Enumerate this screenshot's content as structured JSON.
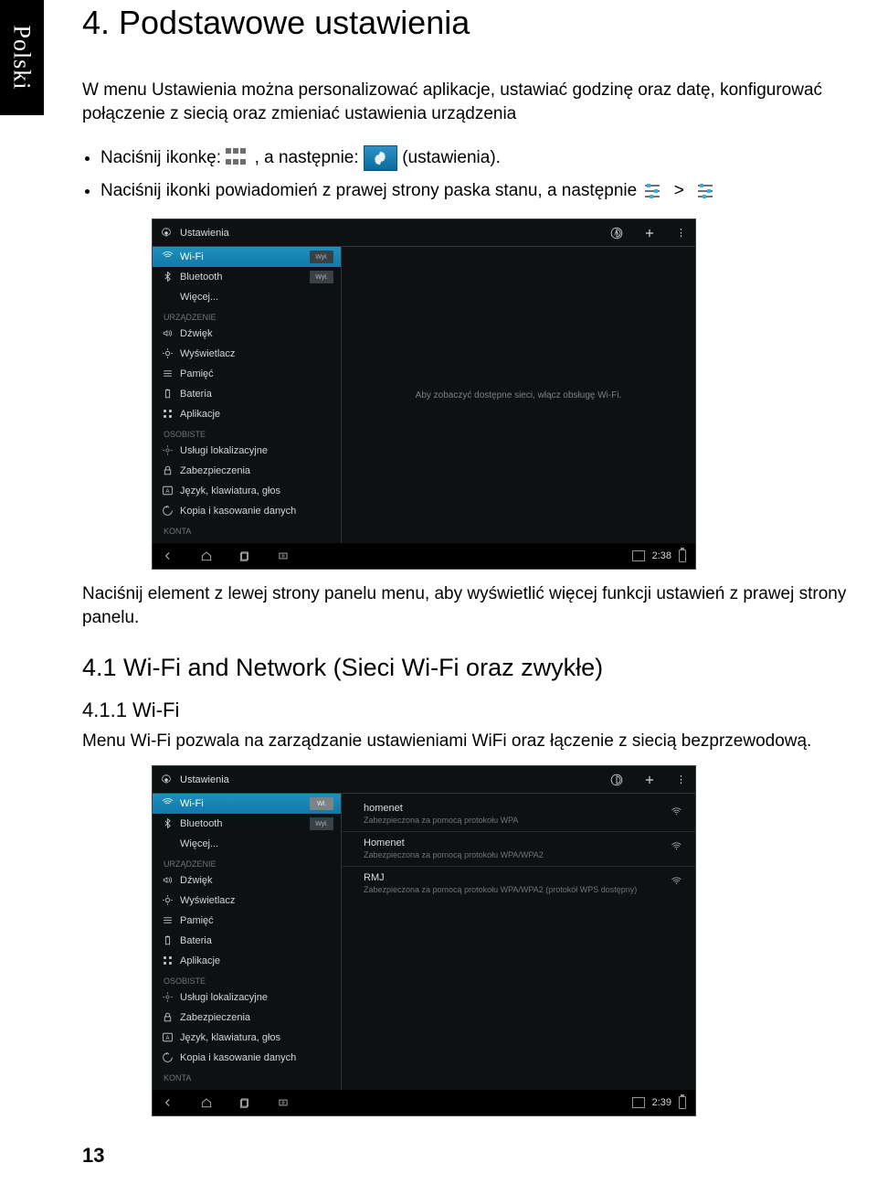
{
  "sidetab": "Polski",
  "heading": "4.  Podstawowe ustawienia",
  "intro": "W menu Ustawienia można personalizować aplikacje, ustawiać godzinę oraz datę, konfigurować połączenie z siecią oraz zmieniać ustawienia urządzenia",
  "bullet1": {
    "t1": "Naciśnij ikonkę:",
    "t2": ",  a następnie:",
    "t3": "(ustawienia).",
    "icons": {
      "apps": "apps-icon",
      "settings_tile": "settings-tile-icon"
    }
  },
  "bullet2": {
    "t1": "Naciśnij ikonki powiadomień z prawej strony paska stanu, a następnie",
    "gt": ">",
    "icons": {
      "sliders1": "quick-sliders-icon",
      "sliders2": "quick-sliders-icon"
    }
  },
  "after_img": "Naciśnij element z lewej strony panelu menu, aby wyświetlić więcej funkcji ustawień z prawej strony panelu.",
  "sub_h2": "4.1   Wi-Fi and Network (Sieci Wi-Fi oraz zwykłe)",
  "sub_h3": "4.1.1   Wi-Fi",
  "wifi_intro": "Menu Wi-Fi pozwala na zarządzanie ustawieniami WiFi oraz łączenie z siecią bezprzewodową.",
  "page_number": "13",
  "screenshot1": {
    "title": "Ustawienia",
    "topbar_icons": [
      "wps-icon",
      "plus-icon",
      "overflow-icon"
    ],
    "sidebar": {
      "primary": [
        {
          "label": "Wi-Fi",
          "icon": "wifi-icon",
          "active": true,
          "toggle": "Wył."
        },
        {
          "label": "Bluetooth",
          "icon": "bluetooth-icon",
          "toggle": "Wył."
        },
        {
          "label": "Więcej...",
          "icon": ""
        }
      ],
      "device_header": "URZĄDZENIE",
      "device": [
        {
          "label": "Dźwięk",
          "icon": "sound-icon"
        },
        {
          "label": "Wyświetlacz",
          "icon": "display-icon"
        },
        {
          "label": "Pamięć",
          "icon": "storage-icon"
        },
        {
          "label": "Bateria",
          "icon": "battery-icon"
        },
        {
          "label": "Aplikacje",
          "icon": "apps-small-icon"
        }
      ],
      "personal_header": "OSOBISTE",
      "personal": [
        {
          "label": "Usługi lokalizacyjne",
          "icon": "location-icon"
        },
        {
          "label": "Zabezpieczenia",
          "icon": "lock-icon"
        },
        {
          "label": "Język, klawiatura, głos",
          "icon": "keyboard-icon"
        },
        {
          "label": "Kopia i kasowanie danych",
          "icon": "backup-icon"
        }
      ],
      "accounts_header": "KONTA"
    },
    "main_hint": "Aby zobaczyć dostępne sieci, włącz obsługę Wi-Fi.",
    "navbar": {
      "time": "2:38",
      "icons": [
        "back-icon",
        "home-icon",
        "recent-icon",
        "screenshot-icon"
      ]
    }
  },
  "screenshot2": {
    "title": "Ustawienia",
    "topbar_icons": [
      "wps-icon",
      "plus-icon",
      "overflow-icon"
    ],
    "sidebar": {
      "primary": [
        {
          "label": "Wi-Fi",
          "icon": "wifi-icon",
          "active": true,
          "toggle": "Wł.",
          "toggle_bright": true
        },
        {
          "label": "Bluetooth",
          "icon": "bluetooth-icon",
          "toggle": "Wył."
        },
        {
          "label": "Więcej...",
          "icon": ""
        }
      ],
      "device_header": "URZĄDZENIE",
      "device": [
        {
          "label": "Dźwięk",
          "icon": "sound-icon"
        },
        {
          "label": "Wyświetlacz",
          "icon": "display-icon"
        },
        {
          "label": "Pamięć",
          "icon": "storage-icon"
        },
        {
          "label": "Bateria",
          "icon": "battery-icon"
        },
        {
          "label": "Aplikacje",
          "icon": "apps-small-icon"
        }
      ],
      "personal_header": "OSOBISTE",
      "personal": [
        {
          "label": "Usługi lokalizacyjne",
          "icon": "location-icon"
        },
        {
          "label": "Zabezpieczenia",
          "icon": "lock-icon"
        },
        {
          "label": "Język, klawiatura, głos",
          "icon": "keyboard-icon"
        },
        {
          "label": "Kopia i kasowanie danych",
          "icon": "backup-icon"
        }
      ],
      "accounts_header": "KONTA"
    },
    "wifi_networks": [
      {
        "name": "homenet",
        "sub": "Zabezpieczona za pomocą protokołu WPA"
      },
      {
        "name": "Homenet",
        "sub": "Zabezpieczona za pomocą protokołu WPA/WPA2"
      },
      {
        "name": "RMJ",
        "sub": "Zabezpieczona za pomocą protokołu WPA/WPA2 (protokół WPS dostępny)"
      }
    ],
    "navbar": {
      "time": "2:39",
      "icons": [
        "back-icon",
        "home-icon",
        "recent-icon",
        "screenshot-icon"
      ]
    }
  }
}
